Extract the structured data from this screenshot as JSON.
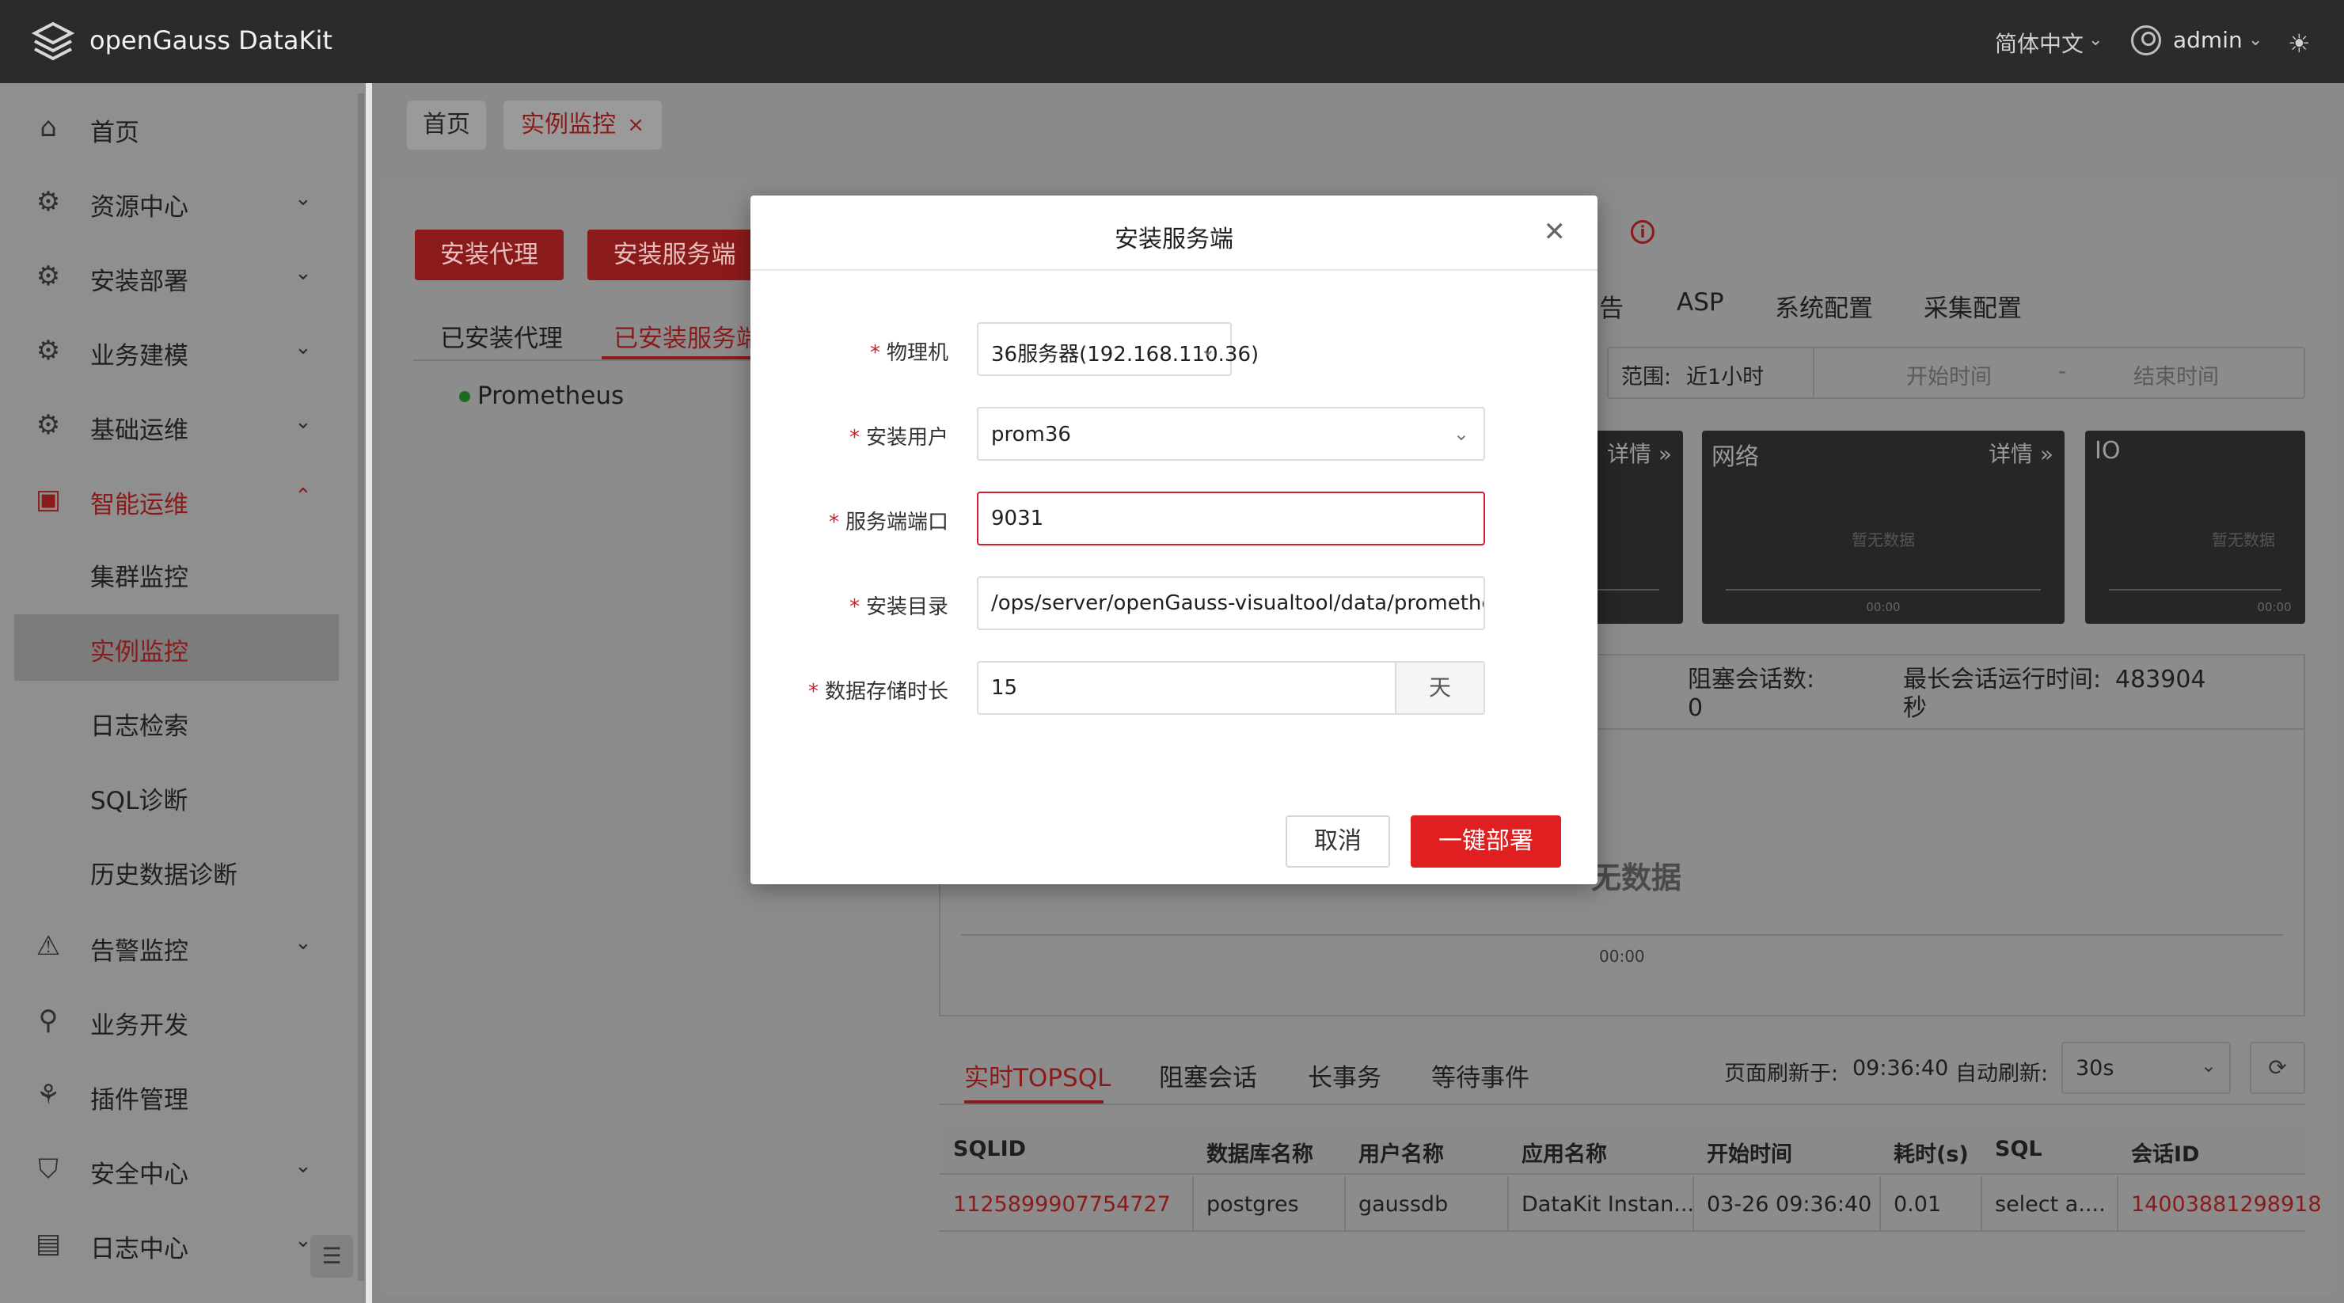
{
  "app": {
    "title": "openGauss DataKit"
  },
  "topbar": {
    "language": "简体中文",
    "user": "admin"
  },
  "sidebar": {
    "items": [
      {
        "label": "首页",
        "icon": "home-icon"
      },
      {
        "label": "资源中心",
        "icon": "gear-icon"
      },
      {
        "label": "安装部署",
        "icon": "gear-icon"
      },
      {
        "label": "业务建模",
        "icon": "gear-icon"
      },
      {
        "label": "基础运维",
        "icon": "gear-icon"
      },
      {
        "label": "智能运维",
        "icon": "monitor-icon"
      },
      {
        "label": "告警监控",
        "icon": "alarm-icon"
      },
      {
        "label": "业务开发",
        "icon": "search-icon"
      },
      {
        "label": "插件管理",
        "icon": "plugin-icon"
      },
      {
        "label": "安全中心",
        "icon": "shield-icon"
      },
      {
        "label": "日志中心",
        "icon": "document-icon"
      }
    ],
    "sub_items": [
      "集群监控",
      "实例监控",
      "日志检索",
      "SQL诊断",
      "历史数据诊断"
    ]
  },
  "tabs": {
    "home": "首页",
    "current": "实例监控",
    "close": "×"
  },
  "main": {
    "btn_install_agent": "安装代理",
    "btn_install_server": "安装服务端",
    "tab_installed_agent": "已安装代理",
    "tab_installed_server": "已安装服务端",
    "prometheus": "Prometheus",
    "right_tabs": [
      "告",
      "ASP",
      "系统配置",
      "采集配置"
    ],
    "range_label": "范围:",
    "range_value": "近1小时",
    "start_placeholder": "开始时间",
    "range_dash": "-",
    "end_placeholder": "结束时间",
    "cards": [
      {
        "title": "",
        "detail": "详情 »",
        "nodata": "",
        "time": ""
      },
      {
        "title": "网络",
        "detail": "详情 »",
        "nodata": "暂无数据",
        "time": "00:00"
      },
      {
        "title": "IO",
        "detail": "",
        "nodata": "暂无数据",
        "time": "00:00"
      }
    ],
    "stat_colon": ":",
    "stat_block_label": "阻塞会话数:",
    "stat_block_value": "0",
    "stat_longest_label": "最长会话运行时间:",
    "stat_longest_value": "483904",
    "stat_longest_unit": "秒",
    "chart_nodata": "无数据",
    "chart_time": "00:00",
    "bottom_tabs": [
      "实时TOPSQL",
      "阻塞会话",
      "长事务",
      "等待事件"
    ],
    "refresh_label": "页面刷新于:",
    "refresh_time": "09:36:40",
    "auto_refresh_label": "自动刷新:",
    "auto_refresh_value": "30s",
    "table": {
      "headers": [
        "SQLID",
        "数据库名称",
        "用户名称",
        "应用名称",
        "开始时间",
        "耗时(s)",
        "SQL",
        "会话ID"
      ],
      "rows": [
        [
          "1125899907754727",
          "postgres",
          "gaussdb",
          "DataKit Instan...",
          "03-26 09:36:40",
          "0.01",
          "select a....",
          "14003881298918"
        ]
      ]
    }
  },
  "modal": {
    "title": "安装服务端",
    "fields": [
      {
        "label": "物理机",
        "value": "36服务器(192.168.110.36)"
      },
      {
        "label": "安装用户",
        "value": "prom36"
      },
      {
        "label": "服务端端口",
        "value": "9031"
      },
      {
        "label": "安装目录",
        "value": "/ops/server/openGauss-visualtool/data/prometheus"
      },
      {
        "label": "数据存储时长",
        "value": "15",
        "suffix": "天"
      }
    ],
    "cancel": "取消",
    "deploy": "一键部署"
  },
  "colors": {
    "accent": "#e02020",
    "topbar": "#2b2b2b",
    "overlay": "#8c8c8c"
  }
}
